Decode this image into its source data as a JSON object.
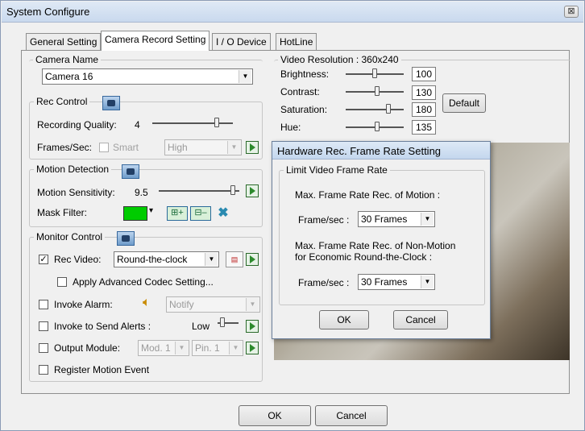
{
  "window": {
    "title": "System Configure",
    "close_glyph": "⊠"
  },
  "tabs": [
    "General Setting",
    "Camera Record Setting",
    "I / O Device",
    "HotLine"
  ],
  "camera_name": {
    "legend": "Camera Name",
    "value": "Camera 16"
  },
  "rec_control": {
    "legend": "Rec Control",
    "quality_label": "Recording Quality:",
    "quality_value": "4",
    "quality_level": 0.82,
    "fps_label": "Frames/Sec:",
    "smart_label": "Smart",
    "smart_checked": false,
    "fps_value": "High"
  },
  "motion_detection": {
    "legend": "Motion Detection",
    "sensitivity_label": "Motion Sensitivity:",
    "sensitivity_value": "9.5",
    "sensitivity_level": 0.95,
    "mask_label": "Mask Filter:",
    "mask_color": "#00cc00"
  },
  "monitor_control": {
    "legend": "Monitor Control",
    "rec_video_label": "Rec Video:",
    "rec_video_checked": true,
    "rec_video_value": "Round-the-clock",
    "advanced_codec_label": "Apply Advanced Codec Setting...",
    "invoke_alarm_label": "Invoke Alarm:",
    "alarm_value": "Notify",
    "send_alerts_label": "Invoke to Send Alerts :",
    "alerts_level_label": "Low",
    "output_module_label": "Output Module:",
    "module_value": "Mod. 1",
    "pin_value": "Pin. 1",
    "register_motion_label": "Register Motion Event"
  },
  "video_resolution": {
    "legend": "Video Resolution : 360x240",
    "brightness_label": "Brightness:",
    "brightness": "100",
    "brightness_level": 0.5,
    "contrast_label": "Contrast:",
    "contrast": "130",
    "contrast_level": 0.55,
    "saturation_label": "Saturation:",
    "saturation": "180",
    "saturation_level": 0.75,
    "hue_label": "Hue:",
    "hue": "135",
    "hue_level": 0.55,
    "default_label": "Default"
  },
  "dialog": {
    "title": "Hardware Rec. Frame Rate Setting",
    "group_legend": "Limit Video Frame Rate",
    "motion_label": "Max. Frame Rate Rec. of Motion :",
    "fps_label": "Frame/sec :",
    "motion_fps": "30 Frames",
    "nonmotion_label_1": "Max. Frame Rate Rec. of Non-Motion",
    "nonmotion_label_2": "for Economic Round-the-Clock :",
    "nonmotion_fps": "30 Frames",
    "ok": "OK",
    "cancel": "Cancel"
  },
  "footer": {
    "ok": "OK",
    "cancel": "Cancel"
  }
}
